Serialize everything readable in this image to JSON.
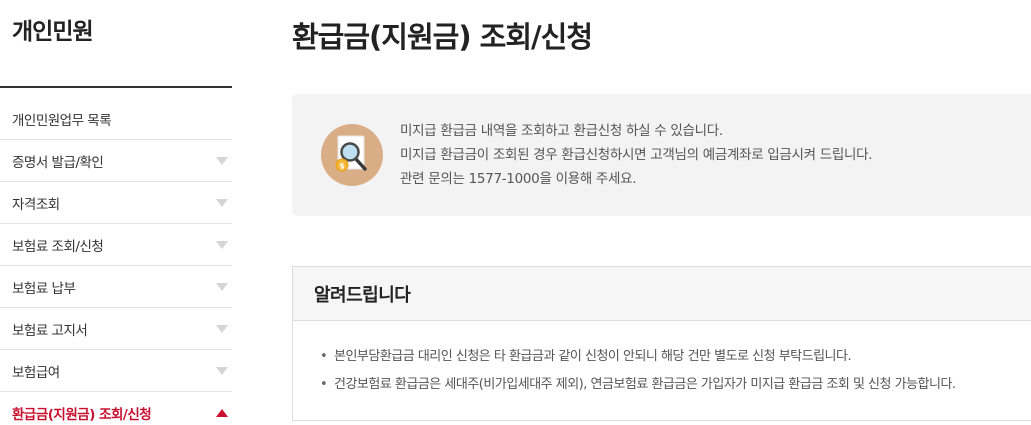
{
  "sidebar": {
    "title": "개인민원",
    "items": [
      {
        "label": "개인민원업무 목록",
        "arrow": "none"
      },
      {
        "label": "증명서 발급/확인",
        "arrow": "down"
      },
      {
        "label": "자격조회",
        "arrow": "down"
      },
      {
        "label": "보험료 조회/신청",
        "arrow": "down"
      },
      {
        "label": "보험료 납부",
        "arrow": "down"
      },
      {
        "label": "보험료 고지서",
        "arrow": "down"
      },
      {
        "label": "보험급여",
        "arrow": "down"
      },
      {
        "label": "환급금(지원금) 조회/신청",
        "arrow": "up",
        "active": true
      }
    ]
  },
  "main": {
    "title": "환급금(지원금) 조회/신청",
    "info": {
      "icon": "search-document-coin-icon",
      "lines": [
        "미지급 환급금 내역을 조회하고 환급신청 하실 수 있습니다.",
        "미지급 환급금이 조회된 경우 환급신청하시면 고객님의 예금계좌로 입금시켜 드립니다.",
        "관련 문의는 1577-1000을 이용해 주세요."
      ]
    },
    "notice": {
      "title": "알려드립니다",
      "bullet": "•",
      "items": [
        "본인부담환급금 대리인 신청은 타 환급금과 같이 신청이 안되니 해당 건만 별도로 신청 부탁드립니다.",
        "건강보험료 환급금은 세대주(비가입세대주 제외), 연금보험료 환급금은 가입자가 미지급 환급금 조회 및 신청 가능합니다."
      ]
    }
  },
  "colors": {
    "accent": "#c8102e",
    "icon_circle": "#d9ae86",
    "info_bg": "#f3f3f3"
  }
}
